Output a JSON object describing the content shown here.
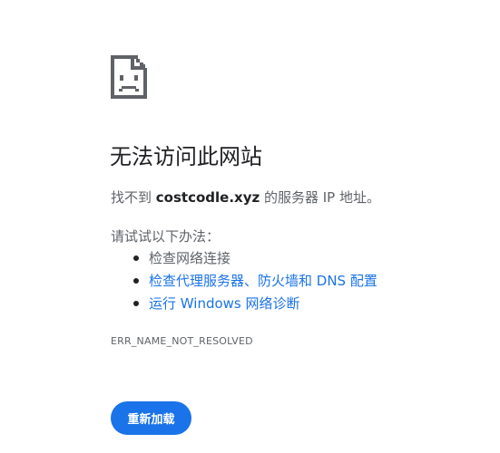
{
  "error_icon": "sad-page-icon",
  "headline": "无法访问此网站",
  "summary": {
    "prefix": "找不到 ",
    "domain": "costcodle.xyz",
    "suffix": " 的服务器 IP 地址。"
  },
  "suggestions": {
    "intro": "请试试以下办法：",
    "items": [
      {
        "label": "检查网络连接",
        "is_link": false
      },
      {
        "label": "检查代理服务器、防火墙和 DNS 配置",
        "is_link": true
      },
      {
        "label": "运行 Windows 网络诊断",
        "is_link": true
      }
    ]
  },
  "error_code": "ERR_NAME_NOT_RESOLVED",
  "reload_button_label": "重新加载",
  "colors": {
    "link": "#1a73e8",
    "button_bg": "#1a73e8",
    "text_primary": "#202124",
    "text_secondary": "#5f6368"
  }
}
